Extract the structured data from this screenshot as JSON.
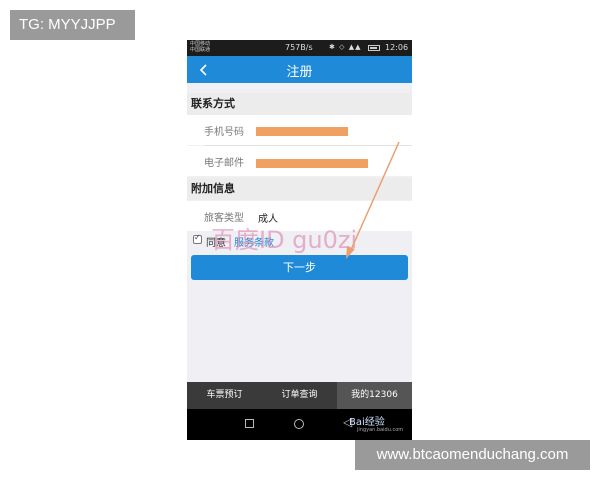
{
  "overlays": {
    "tg_label": "TG: MYYJJPP",
    "site_label": "www.btcaomenduchang.com"
  },
  "status_bar": {
    "carrier_line1": "中国移动",
    "carrier_line2": "中国联通",
    "speed": "757B/s",
    "time": "12:06"
  },
  "nav": {
    "back_icon": "chevron-left-icon",
    "title": "注册"
  },
  "contact_section": {
    "header": "联系方式",
    "phone_label": "手机号码",
    "email_label": "电子邮件"
  },
  "extra_section": {
    "header": "附加信息",
    "passenger_type_label": "旅客类型",
    "passenger_type_value": "成人"
  },
  "agreement": {
    "checked": true,
    "agree_text": "同意",
    "terms_link": "服务条款"
  },
  "next_button": {
    "label": "下一步"
  },
  "watermark": {
    "text": "百度ID gu0zi"
  },
  "tab_bar": {
    "tabs": [
      {
        "label": "车票预订",
        "active": false
      },
      {
        "label": "订单查询",
        "active": false
      },
      {
        "label": "我的12306",
        "active": true
      }
    ]
  },
  "android_nav": {
    "baidu_logo": "Bai经验",
    "baidu_sub": "jingyan.baidu.com"
  },
  "colors": {
    "accent": "#1f8bd8",
    "redaction": "#f0a060",
    "annotation_arrow": "#e8a070"
  }
}
